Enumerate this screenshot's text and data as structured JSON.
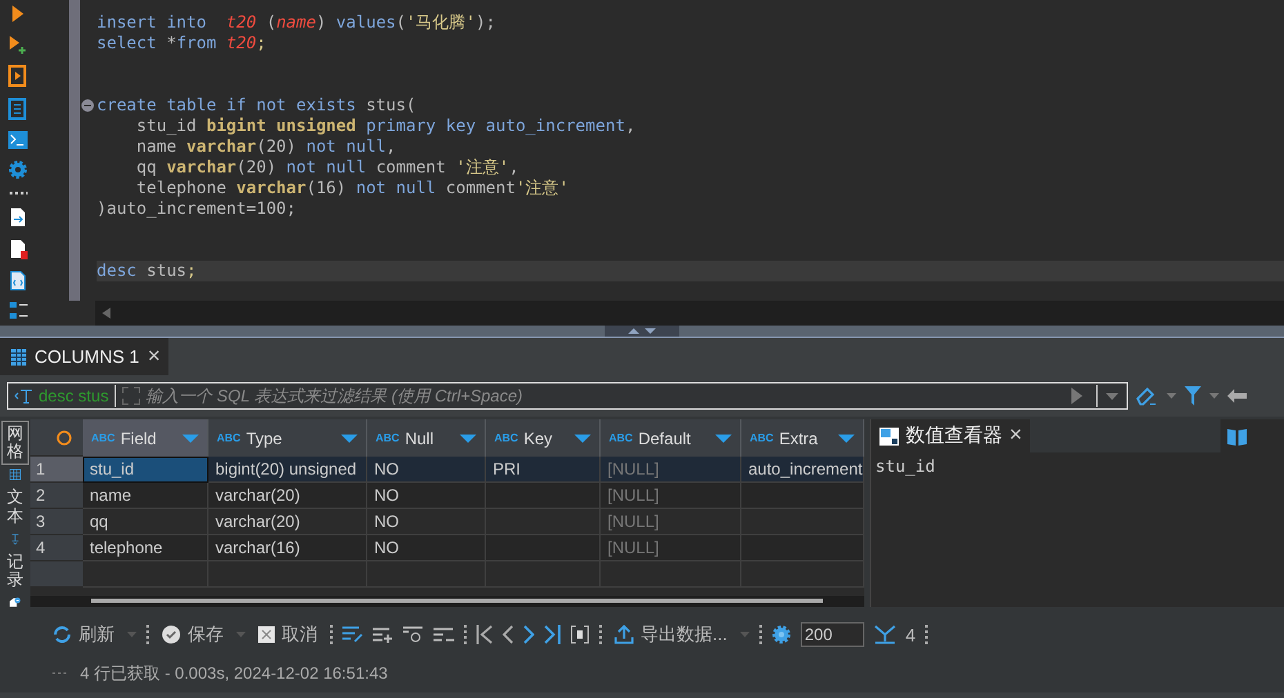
{
  "editor": {
    "lines": [
      {
        "kind": "code",
        "current": false,
        "tokens": [
          {
            "kind": "keyword",
            "text": "insert into  "
          },
          {
            "kind": "table",
            "text": "t20"
          },
          {
            "kind": "plain",
            "text": " ("
          },
          {
            "kind": "table",
            "text": "name"
          },
          {
            "kind": "plain",
            "text": ") "
          },
          {
            "kind": "keyword",
            "text": "values"
          },
          {
            "kind": "plain",
            "text": "("
          },
          {
            "kind": "string",
            "text": "'马化腾'"
          },
          {
            "kind": "plain",
            "text": ");"
          }
        ]
      },
      {
        "kind": "code",
        "current": false,
        "tokens": [
          {
            "kind": "keyword",
            "text": "select "
          },
          {
            "kind": "plain",
            "text": "*"
          },
          {
            "kind": "keyword",
            "text": "from "
          },
          {
            "kind": "table",
            "text": "t20"
          },
          {
            "kind": "string",
            "text": ";"
          }
        ]
      },
      {
        "kind": "blank"
      },
      {
        "kind": "blank"
      },
      {
        "kind": "fold_start",
        "current": false,
        "tokens": [
          {
            "kind": "keyword",
            "text": "create table if not exists "
          },
          {
            "kind": "plain",
            "text": "stus("
          }
        ]
      },
      {
        "kind": "code",
        "current": false,
        "tokens": [
          {
            "kind": "plain",
            "text": "    stu_id "
          },
          {
            "kind": "type",
            "text": "bigint unsigned"
          },
          {
            "kind": "keyword",
            "text": " primary key auto_increment"
          },
          {
            "kind": "plain",
            "text": ","
          }
        ]
      },
      {
        "kind": "code",
        "current": false,
        "tokens": [
          {
            "kind": "plain",
            "text": "    name "
          },
          {
            "kind": "type",
            "text": "varchar"
          },
          {
            "kind": "plain",
            "text": "(20) "
          },
          {
            "kind": "keyword",
            "text": "not null"
          },
          {
            "kind": "plain",
            "text": ","
          }
        ]
      },
      {
        "kind": "code",
        "current": false,
        "tokens": [
          {
            "kind": "plain",
            "text": "    qq "
          },
          {
            "kind": "type",
            "text": "varchar"
          },
          {
            "kind": "plain",
            "text": "(20) "
          },
          {
            "kind": "keyword",
            "text": "not null "
          },
          {
            "kind": "plain",
            "text": "comment "
          },
          {
            "kind": "string",
            "text": "'注意'"
          },
          {
            "kind": "plain",
            "text": ","
          }
        ]
      },
      {
        "kind": "code",
        "current": false,
        "tokens": [
          {
            "kind": "plain",
            "text": "    telephone "
          },
          {
            "kind": "type",
            "text": "varchar"
          },
          {
            "kind": "plain",
            "text": "(16) "
          },
          {
            "kind": "keyword",
            "text": "not null "
          },
          {
            "kind": "plain",
            "text": "comment"
          },
          {
            "kind": "string",
            "text": "'注意'"
          }
        ]
      },
      {
        "kind": "code",
        "current": false,
        "tokens": [
          {
            "kind": "plain",
            "text": ")auto_increment=100;"
          }
        ]
      },
      {
        "kind": "blank"
      },
      {
        "kind": "blank"
      },
      {
        "kind": "code",
        "current": true,
        "tokens": [
          {
            "kind": "keyword",
            "text": "desc "
          },
          {
            "kind": "plain",
            "text": "stus"
          },
          {
            "kind": "string",
            "text": ";"
          }
        ]
      }
    ]
  },
  "results": {
    "tab": {
      "label": "COLUMNS 1",
      "close": "×"
    },
    "filter": {
      "query": "desc stus",
      "placeholder": "输入一个 SQL 表达式来过滤结果 (使用 Ctrl+Space)"
    },
    "side_tabs": [
      {
        "label": "网格",
        "selected": true
      },
      {
        "label": "文本",
        "selected": false
      },
      {
        "label": "记录",
        "selected": false
      }
    ],
    "table": {
      "columns": [
        {
          "label": "Field",
          "badge": "ABC"
        },
        {
          "label": "Type",
          "badge": "ABC"
        },
        {
          "label": "Null",
          "badge": "ABC"
        },
        {
          "label": "Key",
          "badge": "ABC"
        },
        {
          "label": "Default",
          "badge": "ABC"
        },
        {
          "label": "Extra",
          "badge": "ABC"
        }
      ],
      "rows": [
        {
          "number": "1",
          "selected": true,
          "cells": [
            "stu_id",
            "bigint(20) unsigned",
            "NO",
            "PRI",
            "[NULL]",
            "auto_increment"
          ]
        },
        {
          "number": "2",
          "selected": false,
          "cells": [
            "name",
            "varchar(20)",
            "NO",
            "",
            "[NULL]",
            ""
          ]
        },
        {
          "number": "3",
          "selected": false,
          "cells": [
            "qq",
            "varchar(20)",
            "NO",
            "",
            "[NULL]",
            ""
          ]
        },
        {
          "number": "4",
          "selected": false,
          "cells": [
            "telephone",
            "varchar(16)",
            "NO",
            "",
            "[NULL]",
            ""
          ]
        }
      ]
    },
    "value_viewer": {
      "title": "数值查看器",
      "close": "×",
      "value": "stu_id"
    },
    "toolbar": {
      "refresh": "刷新",
      "save": "保存",
      "cancel": "取消",
      "export": "导出数据...",
      "fetch_size": "200",
      "row_count": "4"
    },
    "status": "4 行已获取 - 0.003s, 2024-12-02 16:51:43"
  }
}
